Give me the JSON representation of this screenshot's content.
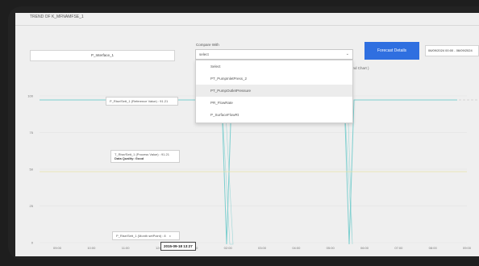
{
  "window": {
    "title": "TREND OF K_MFNAMFSE_1"
  },
  "series_select": {
    "value": "P_Interface_1"
  },
  "comparison": {
    "label": "Compare With",
    "placeholder": "select",
    "options": [
      "Select",
      "PT_PumpInletPress_2",
      "PT_PumpOutletPressure",
      "PR_FlowRate",
      "P_SurfaceFlowRt"
    ],
    "highlighted_index": 2
  },
  "forecast_button": {
    "label": "Forecast Details"
  },
  "date_range": {
    "value": "06/09/2024 00:00 - 06/09/2024"
  },
  "chart_title_fragment": "ater Trend Chart )",
  "chart_data": {
    "type": "line",
    "y_ticks": [
      "100",
      "75",
      "50",
      "25",
      "0"
    ],
    "x_ticks": [
      "09:00",
      "10:00",
      "11:00",
      "12:00",
      "01:00",
      "02:00",
      "03:00",
      "04:00",
      "05:00",
      "06:00",
      "07:00",
      "08:00",
      "09:00"
    ],
    "series": [
      {
        "color": "#7ccfcf"
      },
      {
        "color": "#e7e2a6"
      }
    ]
  },
  "tooltips": {
    "reference": "P_Rise/Sett_1 (Reference Value) : 91.21",
    "process": "T_Rise/Sett_1 (Process Value) : 91.21",
    "quality": "Data Quality: Good",
    "cursor": "P_Rise/Sett_1 (Month setPoint) : 8",
    "cursor_close": "x"
  },
  "x_cursor_badge": "2015-09-18 13:27"
}
